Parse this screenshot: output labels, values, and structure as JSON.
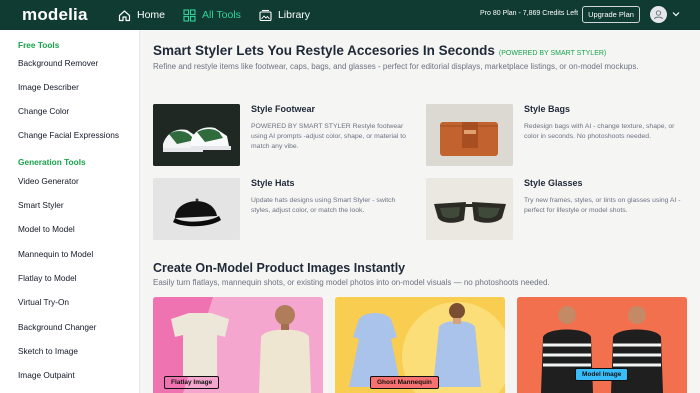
{
  "topbar": {
    "logo": "modelia",
    "nav": [
      {
        "label": "Home",
        "icon": "home-icon"
      },
      {
        "label": "All Tools",
        "icon": "grid-icon",
        "active": true
      },
      {
        "label": "Library",
        "icon": "library-icon"
      }
    ],
    "credits": "Pro 80 Plan - 7,869 Credits Left",
    "upgrade_label": "Upgrade Plan",
    "accent": "#34d399",
    "bg": "#0f3b33"
  },
  "sidebar": {
    "free_header": "Free Tools",
    "free_items": [
      "Background Remover",
      "Image Describer",
      "Change Color",
      "Change Facial Expressions"
    ],
    "gen_header": "Generation Tools",
    "gen_items": [
      "Video Generator",
      "Smart Styler",
      "Model to Model",
      "Mannequin to Model",
      "Flatlay to Model",
      "Virtual Try-On",
      "Background Changer",
      "Sketch to Image",
      "Image Outpaint"
    ]
  },
  "styler": {
    "title": "Smart Styler Lets You Restyle Accesories In Seconds",
    "badge": "(POWERED BY SMART STYLER)",
    "subtitle": "Refine and restyle items like footwear, caps, bags, and glasses - perfect for editorial displays, marketplace listings, or on-model mockups.",
    "cards": [
      {
        "title": "Style Footwear",
        "desc": "POWERED BY SMART STYLER Restyle footwear using AI prompts -adjust color, shape, or material to match any vibe."
      },
      {
        "title": "Style Bags",
        "desc": "Redesign bags with AI - change texture, shape, or color in seconds. No photoshoots needed."
      },
      {
        "title": "Style Hats",
        "desc": "Update hats designs using Smart Styler - switch styles, adjust color, or match the look."
      },
      {
        "title": "Style Glasses",
        "desc": "Try new frames, styles, or tints on glasses using AI - perfect for lifestyle or model shots."
      }
    ]
  },
  "onmodel": {
    "title": "Create On-Model Product Images Instantly",
    "subtitle": "Easily turn flatlays, mannequin shots, or existing model photos into on-model visuals — no photoshoots needed.",
    "promos": [
      {
        "tag": "Flatlay Image",
        "tag_color": "#34d399"
      },
      {
        "tag": "Ghost Mannequin",
        "tag_color": "#f87171"
      },
      {
        "tag": "Model Image",
        "tag_color": "#38bdf8"
      }
    ]
  }
}
